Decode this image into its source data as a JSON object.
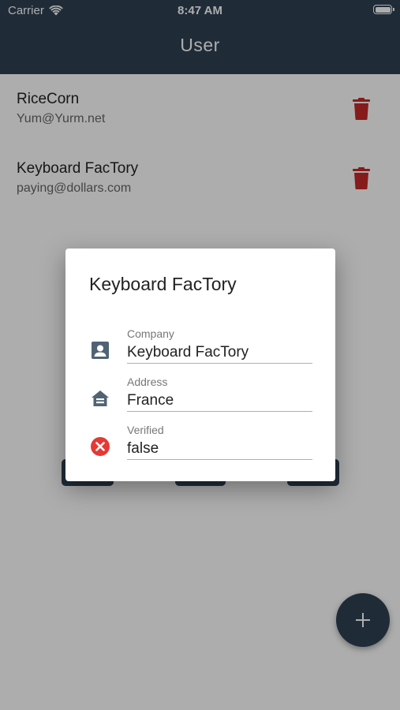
{
  "status_bar": {
    "carrier": "Carrier",
    "time": "8:47 AM"
  },
  "app_bar": {
    "title": "User"
  },
  "users": [
    {
      "name": "RiceCorn",
      "email": "Yum@Yurm.net"
    },
    {
      "name": "Keyboard FacTory",
      "email": "paying@dollars.com"
    }
  ],
  "dialog": {
    "title": "Keyboard FacTory",
    "fields": [
      {
        "label": "Company",
        "value": "Keyboard FacTory",
        "icon": "contact-card-icon"
      },
      {
        "label": "Address",
        "value": "France",
        "icon": "house-icon"
      },
      {
        "label": "Verified",
        "value": "false",
        "icon": "error-circle-icon"
      }
    ]
  },
  "fab": {
    "icon": "plus-icon"
  },
  "colors": {
    "primary": "#2f4153",
    "delete": "#c62828",
    "error": "#e53935",
    "icon_slate": "#4f6374"
  }
}
